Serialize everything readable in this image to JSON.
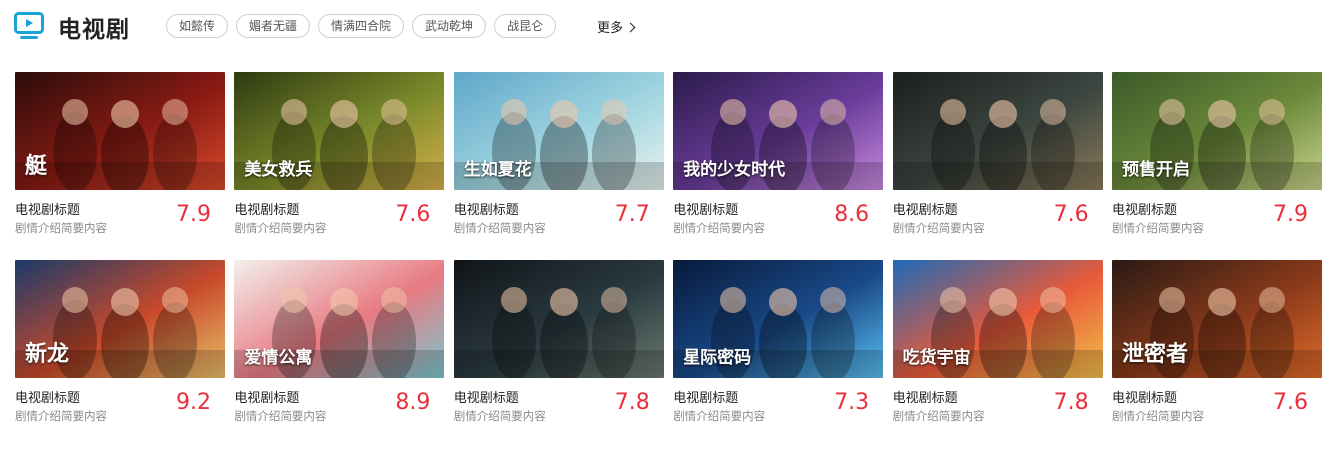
{
  "section": {
    "title": "电视剧",
    "icon": "tv-icon",
    "accent": "#1aa3d9",
    "tags": [
      "如懿传",
      "媚者无疆",
      "情满四合院",
      "武动乾坤",
      "战昆仑"
    ],
    "more_label": "更多"
  },
  "score_color": "#ea2f3a",
  "items": [
    {
      "title": "电视剧标题",
      "desc": "剧情介绍简要内容",
      "score": "7.9",
      "poster_text": "艇",
      "palette": [
        "#2a0d0a",
        "#8a1b14",
        "#d84a2a"
      ]
    },
    {
      "title": "电视剧标题",
      "desc": "剧情介绍简要内容",
      "score": "7.6",
      "poster_text": "美女救兵",
      "palette": [
        "#2f3a12",
        "#7a8a2a",
        "#d9b04a"
      ]
    },
    {
      "title": "电视剧标题",
      "desc": "剧情介绍简要内容",
      "score": "7.7",
      "poster_text": "生如夏花",
      "palette": [
        "#5fa7c9",
        "#9fd4e0",
        "#e8f2ef"
      ]
    },
    {
      "title": "电视剧标题",
      "desc": "剧情介绍简要内容",
      "score": "8.6",
      "poster_text": "我的少女时代",
      "palette": [
        "#2b1b4a",
        "#6a3d9a",
        "#c98ae0"
      ]
    },
    {
      "title": "电视剧标题",
      "desc": "剧情介绍简要内容",
      "score": "7.6",
      "poster_text": "",
      "palette": [
        "#1b1f1d",
        "#3d4640",
        "#8a7a5a"
      ]
    },
    {
      "title": "电视剧标题",
      "desc": "剧情介绍简要内容",
      "score": "7.9",
      "poster_text": "预售开启",
      "palette": [
        "#3a5a2a",
        "#6c8a3a",
        "#c9d48a"
      ]
    },
    {
      "title": "电视剧标题",
      "desc": "剧情介绍简要内容",
      "score": "9.2",
      "poster_text": "新龙",
      "palette": [
        "#1a3a6a",
        "#c94a2a",
        "#e8c06a"
      ]
    },
    {
      "title": "电视剧标题",
      "desc": "剧情介绍简要内容",
      "score": "8.9",
      "poster_text": "爱情公寓",
      "palette": [
        "#f2f0ec",
        "#e87a82",
        "#7ac8d0"
      ]
    },
    {
      "title": "电视剧标题",
      "desc": "剧情介绍简要内容",
      "score": "7.8",
      "poster_text": "",
      "palette": [
        "#101418",
        "#2a3a40",
        "#6a7a70"
      ]
    },
    {
      "title": "电视剧标题",
      "desc": "剧情介绍简要内容",
      "score": "7.3",
      "poster_text": "星际密码",
      "palette": [
        "#071a3a",
        "#1a4a8a",
        "#5ac0f0"
      ]
    },
    {
      "title": "电视剧标题",
      "desc": "剧情介绍简要内容",
      "score": "7.8",
      "poster_text": "吃货宇宙",
      "palette": [
        "#1d6ab8",
        "#e85a3a",
        "#f2c04a"
      ]
    },
    {
      "title": "电视剧标题",
      "desc": "剧情介绍简要内容",
      "score": "7.6",
      "poster_text": "泄密者",
      "palette": [
        "#2a1a14",
        "#8a3a1a",
        "#e06a2a"
      ]
    }
  ]
}
